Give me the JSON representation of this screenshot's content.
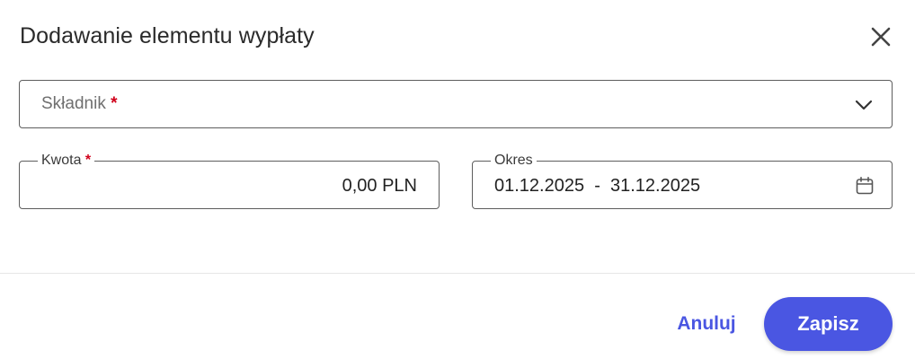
{
  "dialog": {
    "title": "Dodawanie elementu wypłaty"
  },
  "fields": {
    "skladnik": {
      "placeholder": "Składnik",
      "required_mark": "*"
    },
    "kwota": {
      "label": "Kwota",
      "required_mark": "*",
      "value": "0,00 PLN"
    },
    "okres": {
      "label": "Okres",
      "value": "01.12.2025  -  31.12.2025"
    }
  },
  "actions": {
    "cancel_label": "Anuluj",
    "save_label": "Zapisz"
  },
  "icons": {
    "close": "close-icon",
    "dropdown": "chevron-down-icon",
    "calendar": "calendar-icon"
  },
  "colors": {
    "accent": "#4a56e2",
    "required": "#d0021b",
    "border": "#5d5d5d"
  }
}
